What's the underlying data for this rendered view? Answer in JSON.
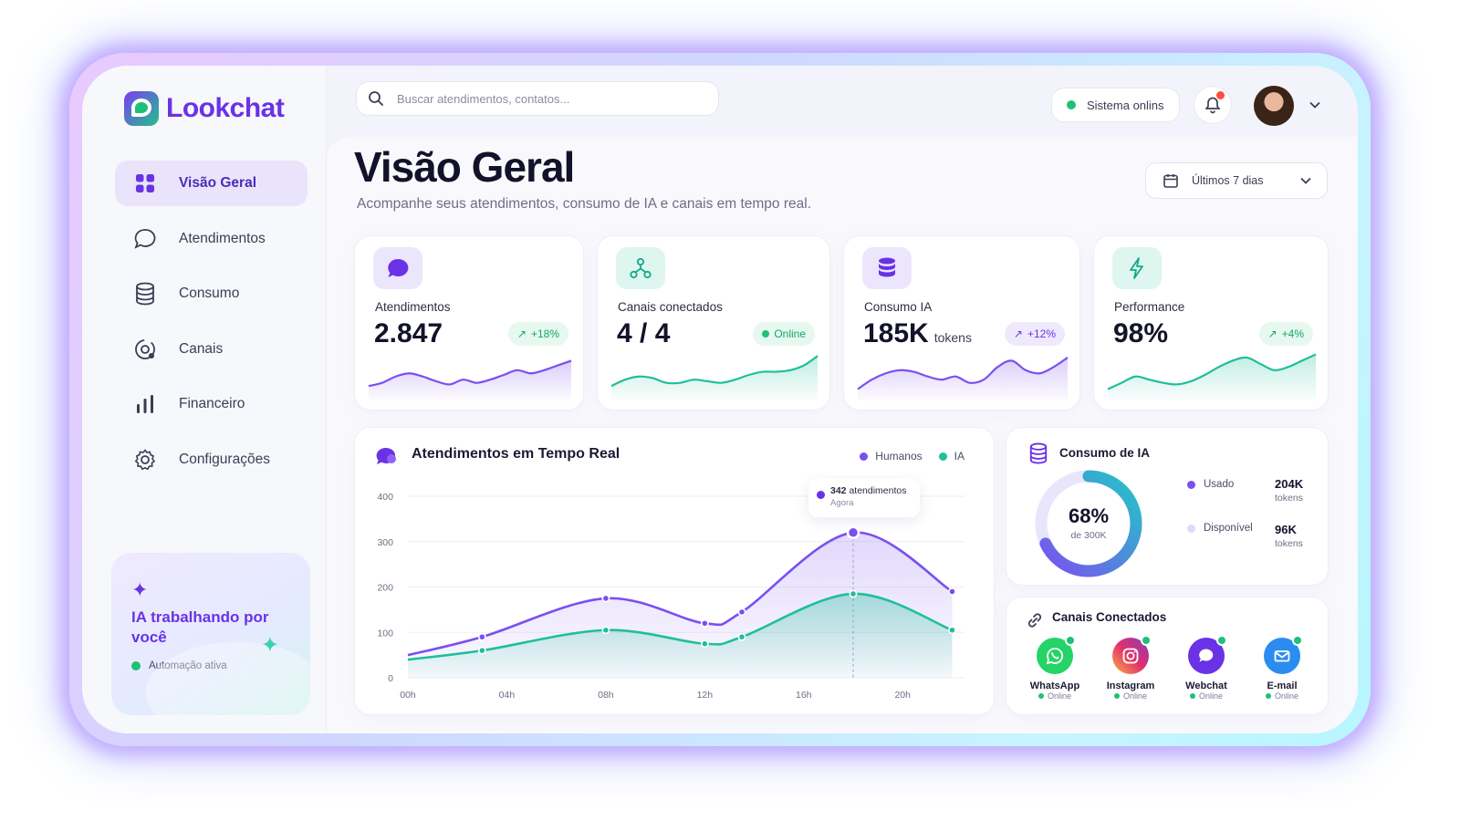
{
  "app": {
    "name": "Lookchat"
  },
  "sidebar": {
    "items": [
      {
        "label": "Visão Geral",
        "icon": "grid-icon",
        "active": true
      },
      {
        "label": "Atendimentos",
        "icon": "chat-bubble-icon"
      },
      {
        "label": "Consumo",
        "icon": "database-icon"
      },
      {
        "label": "Canais",
        "icon": "channels-icon"
      },
      {
        "label": "Financeiro",
        "icon": "bar-chart-icon"
      },
      {
        "label": "Configurações",
        "icon": "gear-icon"
      }
    ],
    "promo": {
      "title": "IA trabalhando por você",
      "status": "Automação ativa"
    }
  },
  "topbar": {
    "search_placeholder": "Buscar atendimentos, contatos...",
    "system_status": "Sistema onlins",
    "notification": true
  },
  "page": {
    "title": "Visão Geral",
    "subtitle": "Acompanhe seus atendimentos, consumo de IA e canais em tempo real.",
    "date_range": "Últimos 7 dias"
  },
  "kpis": [
    {
      "label": "Atendimentos",
      "value": "2.847",
      "unit": "",
      "badge": "+18%",
      "badge_icon": "arrow-up-right-icon",
      "color": "#7b4ff0",
      "spark": [
        8,
        10,
        14,
        16,
        14,
        11,
        9,
        12,
        10,
        12,
        15,
        18,
        16,
        18,
        21,
        24
      ]
    },
    {
      "label": "Canais conectados",
      "value": "4 / 4",
      "unit": "",
      "badge": "Online",
      "badge_icon": "status-dot",
      "color": "#1fbf9a",
      "spark": [
        8,
        12,
        14,
        13,
        10,
        10,
        12,
        11,
        10,
        12,
        15,
        17,
        17,
        18,
        21,
        27
      ]
    },
    {
      "label": "Consumo IA",
      "value": "185K",
      "unit": "tokens",
      "badge": "+12%",
      "badge_icon": "arrow-up-right-icon",
      "color": "#7b4ff0",
      "spark": [
        6,
        12,
        16,
        18,
        17,
        14,
        12,
        14,
        10,
        12,
        20,
        24,
        18,
        16,
        20,
        26
      ]
    },
    {
      "label": "Performance",
      "value": "98%",
      "unit": "",
      "badge": "+4%",
      "badge_icon": "arrow-up-right-icon",
      "color": "#1fbf9a",
      "spark": [
        6,
        10,
        14,
        12,
        10,
        9,
        11,
        15,
        20,
        24,
        26,
        22,
        18,
        20,
        24,
        28
      ]
    }
  ],
  "realtime": {
    "title": "Atendimentos em Tempo Real",
    "legend": [
      {
        "name": "Humanos",
        "color": "#7b4ff0"
      },
      {
        "name": "IA",
        "color": "#1fbf9a"
      }
    ],
    "tooltip": {
      "value": "342",
      "label": "atendimentos",
      "sub": "Agora"
    }
  },
  "chart_data": {
    "type": "area",
    "x": [
      0,
      3,
      8,
      12,
      13.5,
      18,
      22
    ],
    "xticks": [
      "00h",
      "04h",
      "08h",
      "12h",
      "16h",
      "20h"
    ],
    "xtick_values": [
      0,
      4,
      8,
      12,
      16,
      20
    ],
    "xlim": [
      0,
      22.5
    ],
    "ylim": [
      0,
      400
    ],
    "yticks": [
      0,
      100,
      200,
      300,
      400
    ],
    "series": [
      {
        "name": "Humanos",
        "color": "#7b4ff0",
        "values": [
          50,
          90,
          175,
          120,
          145,
          320,
          190
        ]
      },
      {
        "name": "IA",
        "color": "#1fbf9a",
        "values": [
          40,
          60,
          105,
          75,
          90,
          185,
          105
        ]
      }
    ],
    "grid": true,
    "legend": "top-right"
  },
  "ia_usage": {
    "title": "Consumo de IA",
    "percent": 68,
    "percent_label": "68%",
    "of_label": "de 300K",
    "used": {
      "label": "Usado",
      "value": "204K",
      "unit": "tokens",
      "color": "#7b4ff0"
    },
    "available": {
      "label": "Disponível",
      "value": "96K",
      "unit": "tokens",
      "color": "#d9dbff"
    }
  },
  "channels": {
    "title": "Canais Conectados",
    "items": [
      {
        "name": "WhatsApp",
        "status": "Online",
        "color": "#25d366",
        "icon": "whatsapp-icon"
      },
      {
        "name": "Instagram",
        "status": "Online",
        "color": "#e1306c",
        "icon": "instagram-icon"
      },
      {
        "name": "Webchat",
        "status": "Online",
        "color": "#6a32e6",
        "icon": "webchat-icon"
      },
      {
        "name": "E-mail",
        "status": "Online",
        "color": "#2b8cf0",
        "icon": "email-icon"
      }
    ]
  }
}
